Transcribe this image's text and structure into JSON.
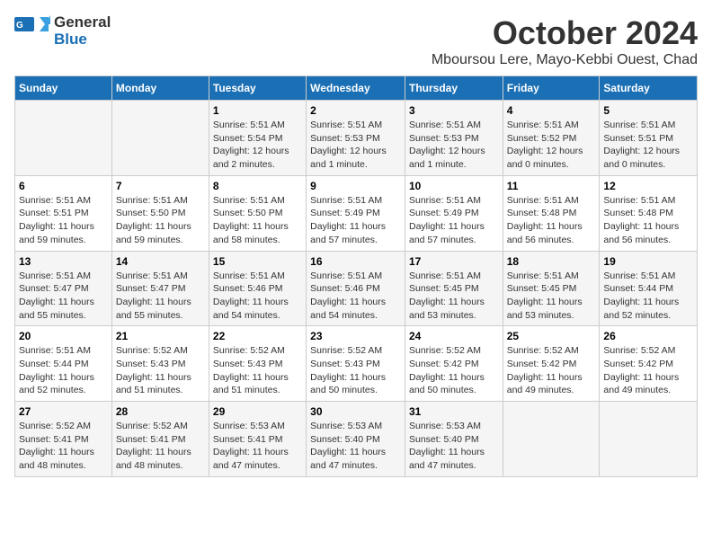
{
  "header": {
    "logo_line1": "General",
    "logo_line2": "Blue",
    "month": "October 2024",
    "location": "Mboursou Lere, Mayo-Kebbi Ouest, Chad"
  },
  "weekdays": [
    "Sunday",
    "Monday",
    "Tuesday",
    "Wednesday",
    "Thursday",
    "Friday",
    "Saturday"
  ],
  "weeks": [
    [
      {
        "day": "",
        "info": ""
      },
      {
        "day": "",
        "info": ""
      },
      {
        "day": "1",
        "info": "Sunrise: 5:51 AM\nSunset: 5:54 PM\nDaylight: 12 hours\nand 2 minutes."
      },
      {
        "day": "2",
        "info": "Sunrise: 5:51 AM\nSunset: 5:53 PM\nDaylight: 12 hours\nand 1 minute."
      },
      {
        "day": "3",
        "info": "Sunrise: 5:51 AM\nSunset: 5:53 PM\nDaylight: 12 hours\nand 1 minute."
      },
      {
        "day": "4",
        "info": "Sunrise: 5:51 AM\nSunset: 5:52 PM\nDaylight: 12 hours\nand 0 minutes."
      },
      {
        "day": "5",
        "info": "Sunrise: 5:51 AM\nSunset: 5:51 PM\nDaylight: 12 hours\nand 0 minutes."
      }
    ],
    [
      {
        "day": "6",
        "info": "Sunrise: 5:51 AM\nSunset: 5:51 PM\nDaylight: 11 hours\nand 59 minutes."
      },
      {
        "day": "7",
        "info": "Sunrise: 5:51 AM\nSunset: 5:50 PM\nDaylight: 11 hours\nand 59 minutes."
      },
      {
        "day": "8",
        "info": "Sunrise: 5:51 AM\nSunset: 5:50 PM\nDaylight: 11 hours\nand 58 minutes."
      },
      {
        "day": "9",
        "info": "Sunrise: 5:51 AM\nSunset: 5:49 PM\nDaylight: 11 hours\nand 57 minutes."
      },
      {
        "day": "10",
        "info": "Sunrise: 5:51 AM\nSunset: 5:49 PM\nDaylight: 11 hours\nand 57 minutes."
      },
      {
        "day": "11",
        "info": "Sunrise: 5:51 AM\nSunset: 5:48 PM\nDaylight: 11 hours\nand 56 minutes."
      },
      {
        "day": "12",
        "info": "Sunrise: 5:51 AM\nSunset: 5:48 PM\nDaylight: 11 hours\nand 56 minutes."
      }
    ],
    [
      {
        "day": "13",
        "info": "Sunrise: 5:51 AM\nSunset: 5:47 PM\nDaylight: 11 hours\nand 55 minutes."
      },
      {
        "day": "14",
        "info": "Sunrise: 5:51 AM\nSunset: 5:47 PM\nDaylight: 11 hours\nand 55 minutes."
      },
      {
        "day": "15",
        "info": "Sunrise: 5:51 AM\nSunset: 5:46 PM\nDaylight: 11 hours\nand 54 minutes."
      },
      {
        "day": "16",
        "info": "Sunrise: 5:51 AM\nSunset: 5:46 PM\nDaylight: 11 hours\nand 54 minutes."
      },
      {
        "day": "17",
        "info": "Sunrise: 5:51 AM\nSunset: 5:45 PM\nDaylight: 11 hours\nand 53 minutes."
      },
      {
        "day": "18",
        "info": "Sunrise: 5:51 AM\nSunset: 5:45 PM\nDaylight: 11 hours\nand 53 minutes."
      },
      {
        "day": "19",
        "info": "Sunrise: 5:51 AM\nSunset: 5:44 PM\nDaylight: 11 hours\nand 52 minutes."
      }
    ],
    [
      {
        "day": "20",
        "info": "Sunrise: 5:51 AM\nSunset: 5:44 PM\nDaylight: 11 hours\nand 52 minutes."
      },
      {
        "day": "21",
        "info": "Sunrise: 5:52 AM\nSunset: 5:43 PM\nDaylight: 11 hours\nand 51 minutes."
      },
      {
        "day": "22",
        "info": "Sunrise: 5:52 AM\nSunset: 5:43 PM\nDaylight: 11 hours\nand 51 minutes."
      },
      {
        "day": "23",
        "info": "Sunrise: 5:52 AM\nSunset: 5:43 PM\nDaylight: 11 hours\nand 50 minutes."
      },
      {
        "day": "24",
        "info": "Sunrise: 5:52 AM\nSunset: 5:42 PM\nDaylight: 11 hours\nand 50 minutes."
      },
      {
        "day": "25",
        "info": "Sunrise: 5:52 AM\nSunset: 5:42 PM\nDaylight: 11 hours\nand 49 minutes."
      },
      {
        "day": "26",
        "info": "Sunrise: 5:52 AM\nSunset: 5:42 PM\nDaylight: 11 hours\nand 49 minutes."
      }
    ],
    [
      {
        "day": "27",
        "info": "Sunrise: 5:52 AM\nSunset: 5:41 PM\nDaylight: 11 hours\nand 48 minutes."
      },
      {
        "day": "28",
        "info": "Sunrise: 5:52 AM\nSunset: 5:41 PM\nDaylight: 11 hours\nand 48 minutes."
      },
      {
        "day": "29",
        "info": "Sunrise: 5:53 AM\nSunset: 5:41 PM\nDaylight: 11 hours\nand 47 minutes."
      },
      {
        "day": "30",
        "info": "Sunrise: 5:53 AM\nSunset: 5:40 PM\nDaylight: 11 hours\nand 47 minutes."
      },
      {
        "day": "31",
        "info": "Sunrise: 5:53 AM\nSunset: 5:40 PM\nDaylight: 11 hours\nand 47 minutes."
      },
      {
        "day": "",
        "info": ""
      },
      {
        "day": "",
        "info": ""
      }
    ]
  ]
}
